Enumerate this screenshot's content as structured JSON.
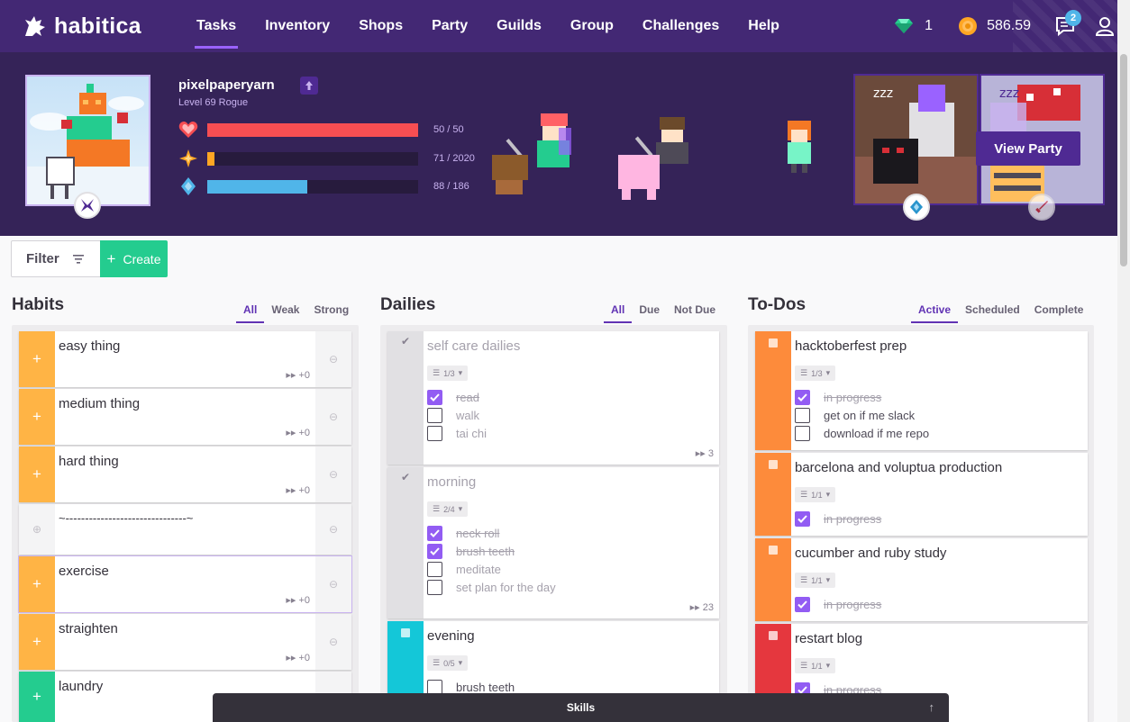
{
  "app": {
    "name": "habitica"
  },
  "nav": {
    "items": [
      {
        "label": "Tasks",
        "active": true
      },
      {
        "label": "Inventory",
        "active": false
      },
      {
        "label": "Shops",
        "active": false
      },
      {
        "label": "Party",
        "active": false
      },
      {
        "label": "Guilds",
        "active": false
      },
      {
        "label": "Group",
        "active": false
      },
      {
        "label": "Challenges",
        "active": false
      },
      {
        "label": "Help",
        "active": false
      }
    ],
    "gems": "1",
    "gold": "586.59",
    "notifications": "2"
  },
  "user": {
    "name": "pixelpaperyarn",
    "level": "Level 69 Rogue",
    "stats": {
      "health": {
        "text": "50 / 50",
        "fraction": 1.0,
        "color": "#f74e52"
      },
      "experience": {
        "text": "71 / 2020",
        "fraction": 0.035,
        "color": "#ffa623"
      },
      "mana": {
        "text": "88 / 186",
        "fraction": 0.473,
        "color": "#50b5e9"
      }
    }
  },
  "party": {
    "view_label": "View Party"
  },
  "toolbar": {
    "filter_label": "Filter",
    "create_label": "Create"
  },
  "columns": {
    "habits": {
      "title": "Habits",
      "tabs": [
        "All",
        "Weak",
        "Strong"
      ],
      "cards": [
        {
          "title": "easy thing",
          "counter": "+0"
        },
        {
          "title": "medium thing",
          "counter": "+0"
        },
        {
          "title": "hard thing",
          "counter": "+0"
        },
        {
          "title": "~-------------------------------~",
          "counter": ""
        },
        {
          "title": "exercise",
          "counter": "+0"
        },
        {
          "title": "straighten",
          "counter": "+0"
        },
        {
          "title": "laundry",
          "counter": ""
        }
      ]
    },
    "dailies": {
      "title": "Dailies",
      "tabs": [
        "All",
        "Due",
        "Not Due"
      ],
      "cards": [
        {
          "title": "self care dailies",
          "checklist": "1/3",
          "streak": "3",
          "items": [
            {
              "text": "read",
              "done": true
            },
            {
              "text": "walk",
              "done": false
            },
            {
              "text": "tai chi",
              "done": false
            }
          ]
        },
        {
          "title": "morning",
          "checklist": "2/4",
          "streak": "23",
          "items": [
            {
              "text": "neck roll",
              "done": true
            },
            {
              "text": "brush teeth",
              "done": true
            },
            {
              "text": "meditate",
              "done": false
            },
            {
              "text": "set plan for the day",
              "done": false
            }
          ]
        },
        {
          "title": "evening",
          "checklist": "0/5",
          "streak": "",
          "items": [
            {
              "text": "brush teeth",
              "done": false
            }
          ]
        }
      ]
    },
    "todos": {
      "title": "To-Dos",
      "tabs": [
        "Active",
        "Scheduled",
        "Complete"
      ],
      "cards": [
        {
          "title": "hacktoberfest prep",
          "checklist": "1/3",
          "items": [
            {
              "text": "in progress",
              "done": true
            },
            {
              "text": "get on if me slack",
              "done": false
            },
            {
              "text": "download if me repo",
              "done": false
            }
          ]
        },
        {
          "title": "barcelona and voluptua production",
          "checklist": "1/1",
          "items": [
            {
              "text": "in progress",
              "done": true
            }
          ]
        },
        {
          "title": "cucumber and ruby study",
          "checklist": "1/1",
          "items": [
            {
              "text": "in progress",
              "done": true
            }
          ]
        },
        {
          "title": "restart blog",
          "checklist": "1/1",
          "items": [
            {
              "text": "in progress",
              "done": true
            }
          ]
        }
      ]
    }
  },
  "skills": {
    "label": "Skills"
  }
}
